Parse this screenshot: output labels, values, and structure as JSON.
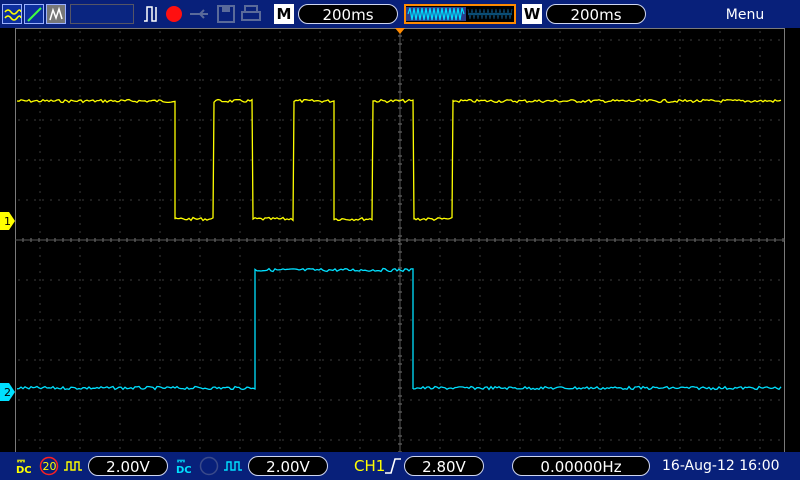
{
  "topbar": {
    "icons": [
      "run-mode-icon",
      "cursor-icon",
      "display-icon",
      "trigger-icon",
      "record-icon",
      "usb-icon",
      "save-icon",
      "print-icon"
    ],
    "main_timebase_label": "M",
    "main_timebase": "200ms",
    "window_label": "W",
    "window_timebase": "200ms",
    "menu_label": "Menu"
  },
  "channels": [
    {
      "id": "1",
      "color": "#ffff00",
      "coupling": "DC",
      "bw_limit": "20",
      "volts_per_div": "2.00V"
    },
    {
      "id": "2",
      "color": "#00e0ff",
      "coupling": "DC",
      "volts_per_div": "2.00V"
    }
  ],
  "trigger": {
    "source": "CH1",
    "edge": "rising",
    "level": "2.80V"
  },
  "frequency": "0.00000Hz",
  "datetime": "16-Aug-12 16:00",
  "colors": {
    "bar_bg": "#08207a",
    "ch1": "#ffff00",
    "ch2": "#00e0ff",
    "grid": "#7a7a7a"
  }
}
